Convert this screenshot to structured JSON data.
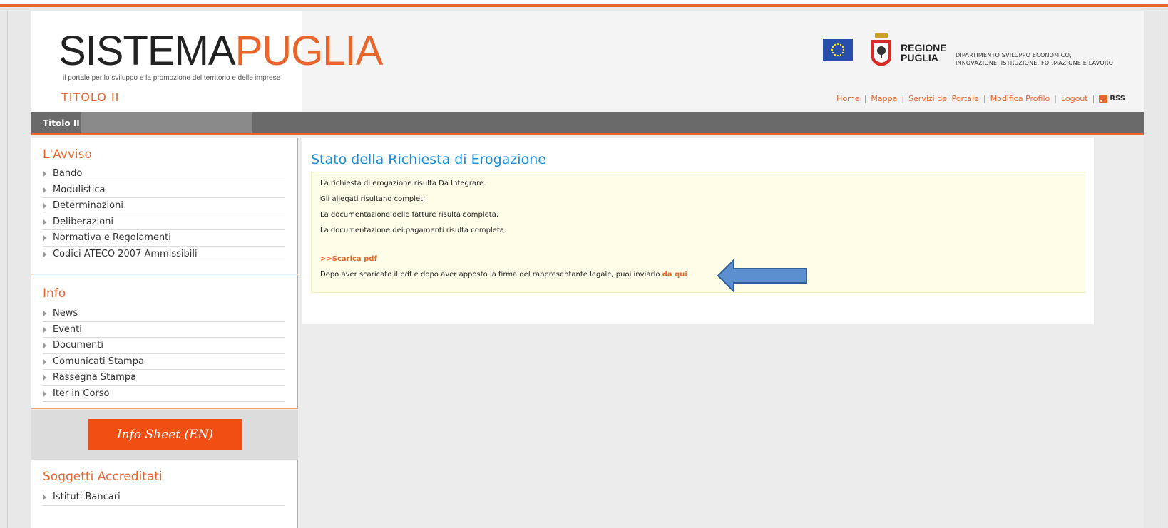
{
  "header": {
    "logo_part1": "SISTEMA",
    "logo_part2": "PUGLIA",
    "tagline": "il portale per lo sviluppo e la promozione del territorio e delle imprese",
    "section_title": "TITOLO II",
    "region_line1": "REGIONE",
    "region_line2": "PUGLIA",
    "department_line1": "DIPARTIMENTO SVILUPPO ECONOMICO,",
    "department_line2": "INNOVAZIONE, ISTRUZIONE, FORMAZIONE E LAVORO",
    "links": [
      "Home",
      "Mappa",
      "Servizi del Portale",
      "Modifica Profilo",
      "Logout"
    ],
    "rss_label": "RSS"
  },
  "navbar": {
    "breadcrumb": "Titolo II -"
  },
  "sidebar": {
    "avviso_title": "L'Avviso",
    "avviso_items": [
      "Bando",
      "Modulistica",
      "Determinazioni",
      "Deliberazioni",
      "Normativa e Regolamenti",
      "Codici ATECO 2007 Ammissibili"
    ],
    "info_title": "Info",
    "info_items": [
      "News",
      "Eventi",
      "Documenti",
      "Comunicati Stampa",
      "Rassegna Stampa",
      "Iter in Corso"
    ],
    "info_sheet_button": "Info Sheet (EN)",
    "soggetti_title": "Soggetti Accreditati",
    "soggetti_items": [
      "Istituti Bancari"
    ]
  },
  "main": {
    "title": "Stato della Richiesta di Erogazione",
    "lines": [
      "La richiesta di erogazione risulta Da Integrare.",
      "Gli allegati risultano completi.",
      "La documentazione delle fatture risulta completa.",
      "La documentazione dei pagamenti risulta completa."
    ],
    "download_link": ">>Scarica pdf",
    "send_text": "Dopo aver scaricato il pdf e dopo aver apposto la firma del rappresentante legale, puoi inviarlo ",
    "send_link": "da qui"
  },
  "colors": {
    "accent": "#e8662c",
    "title_blue": "#1a8fd9",
    "annotation_arrow": "#5b8fcf"
  }
}
